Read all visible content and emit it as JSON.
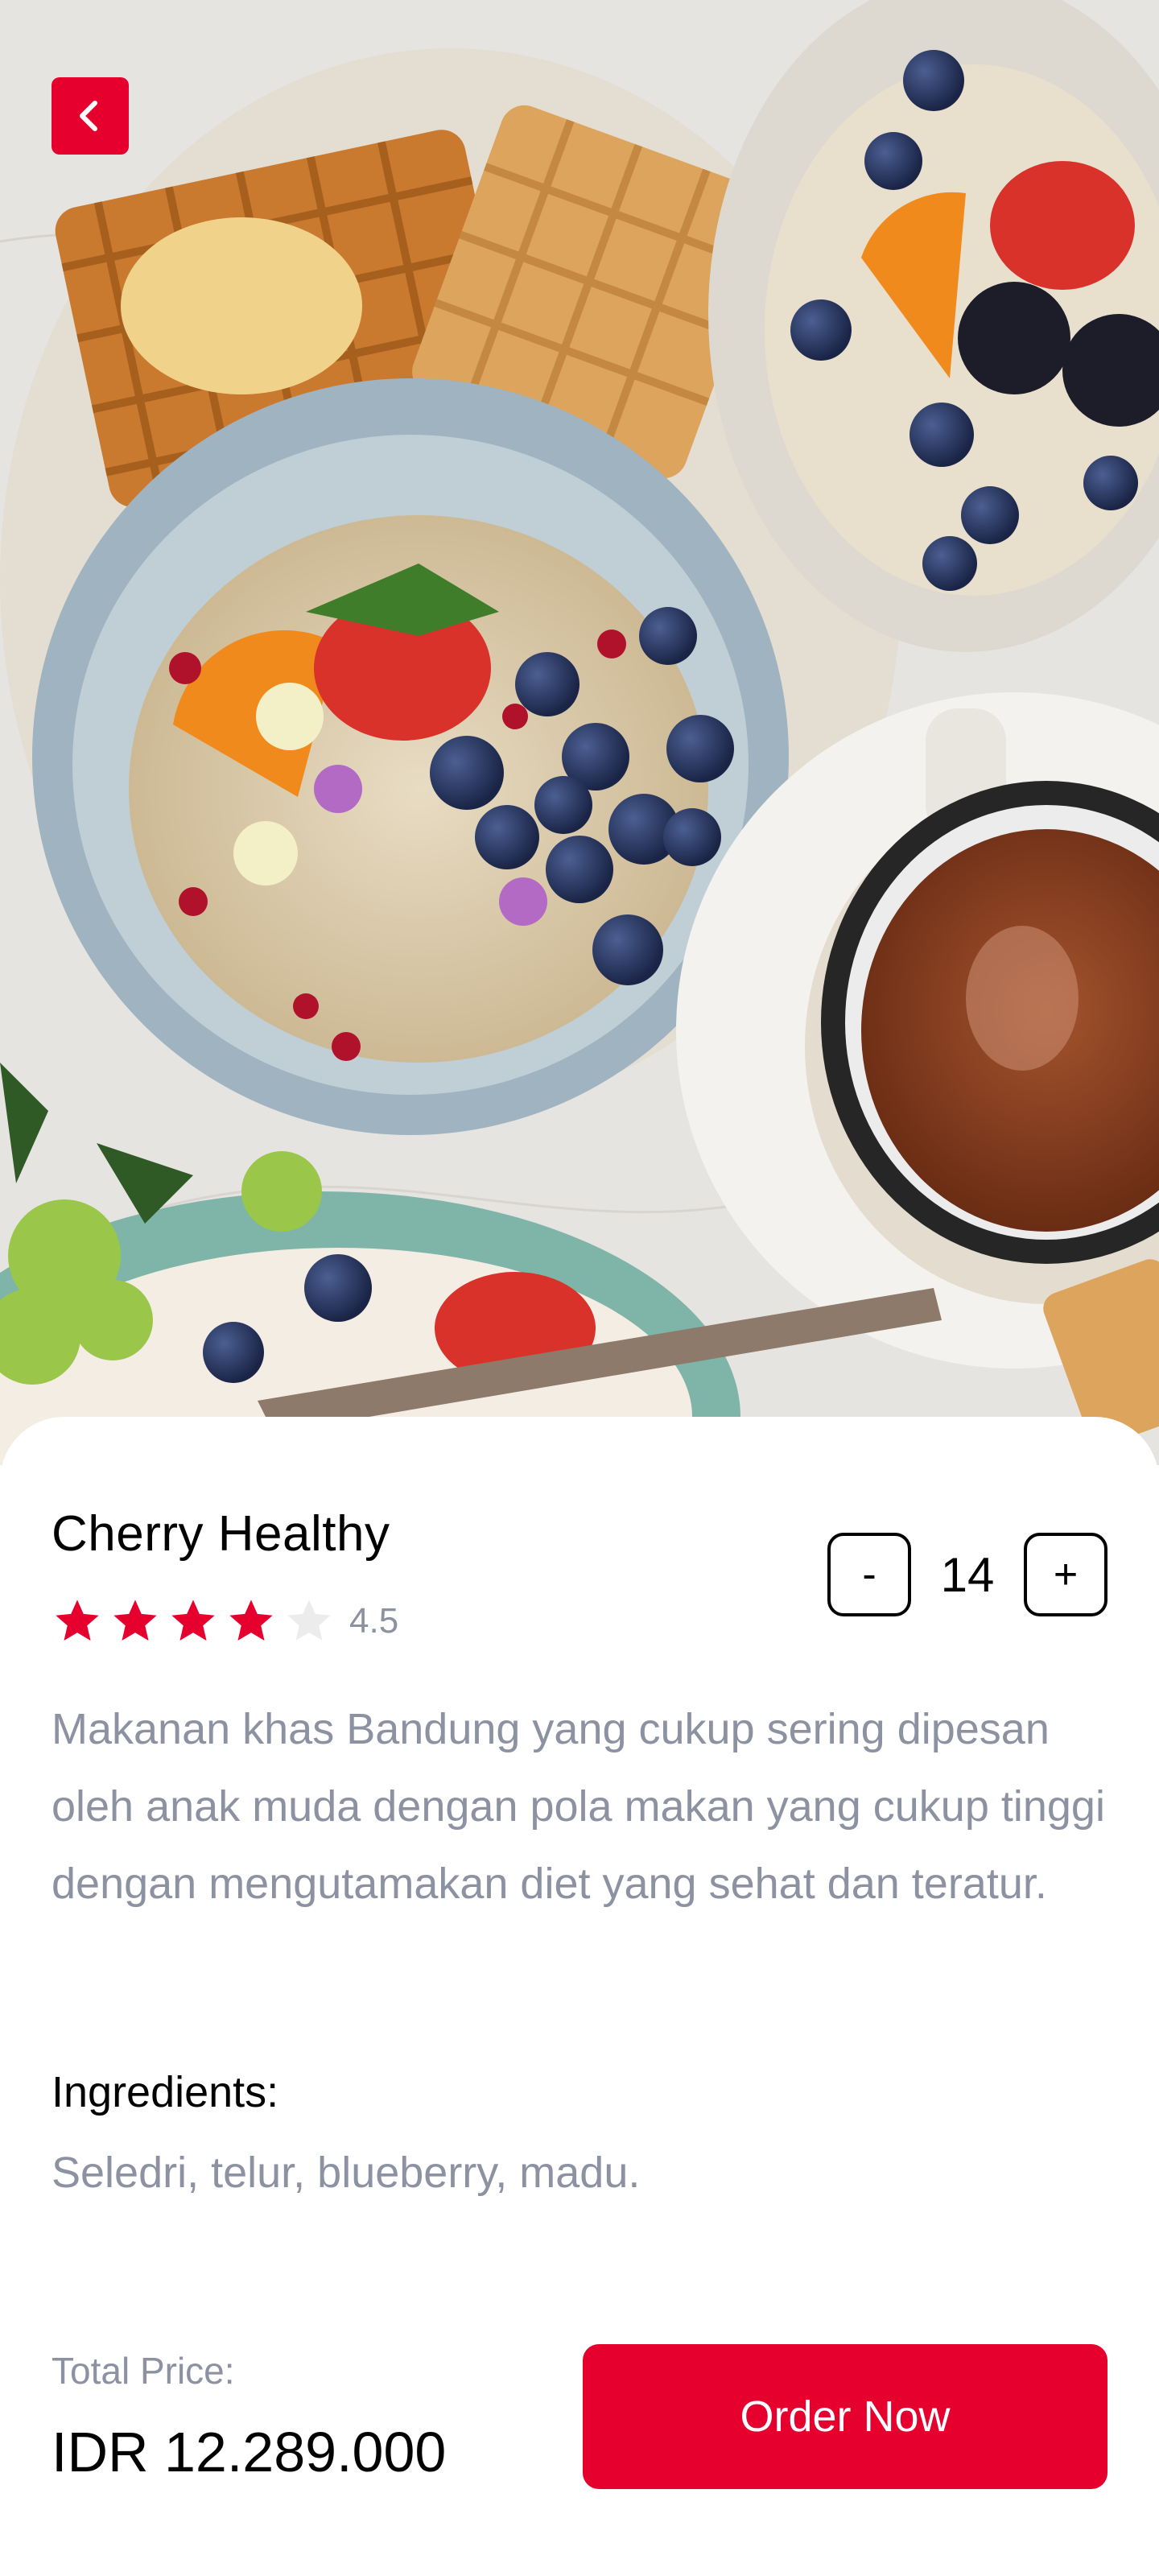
{
  "header": {
    "back_icon": "chevron-left-icon",
    "accent_color": "#E6002E"
  },
  "hero": {
    "image_subject": "breakfast-bowls-photo"
  },
  "food": {
    "name": "Cherry Healthy",
    "rating_value": "4.5",
    "rating_stars": 4.5,
    "star_color": "#E6002E",
    "star_empty_color": "#ECECEC",
    "quantity": "14",
    "minus_label": "-",
    "plus_label": "+",
    "description": "Makanan khas Bandung yang cukup sering dipesan oleh anak muda dengan pola makan yang cukup tinggi dengan mengutamakan diet yang sehat dan teratur.",
    "ingredients_title": "Ingredients:",
    "ingredients": "Seledri, telur, blueberry, madu."
  },
  "checkout": {
    "total_label": "Total Price:",
    "total_value": "IDR 12.289.000",
    "order_label": "Order Now"
  }
}
